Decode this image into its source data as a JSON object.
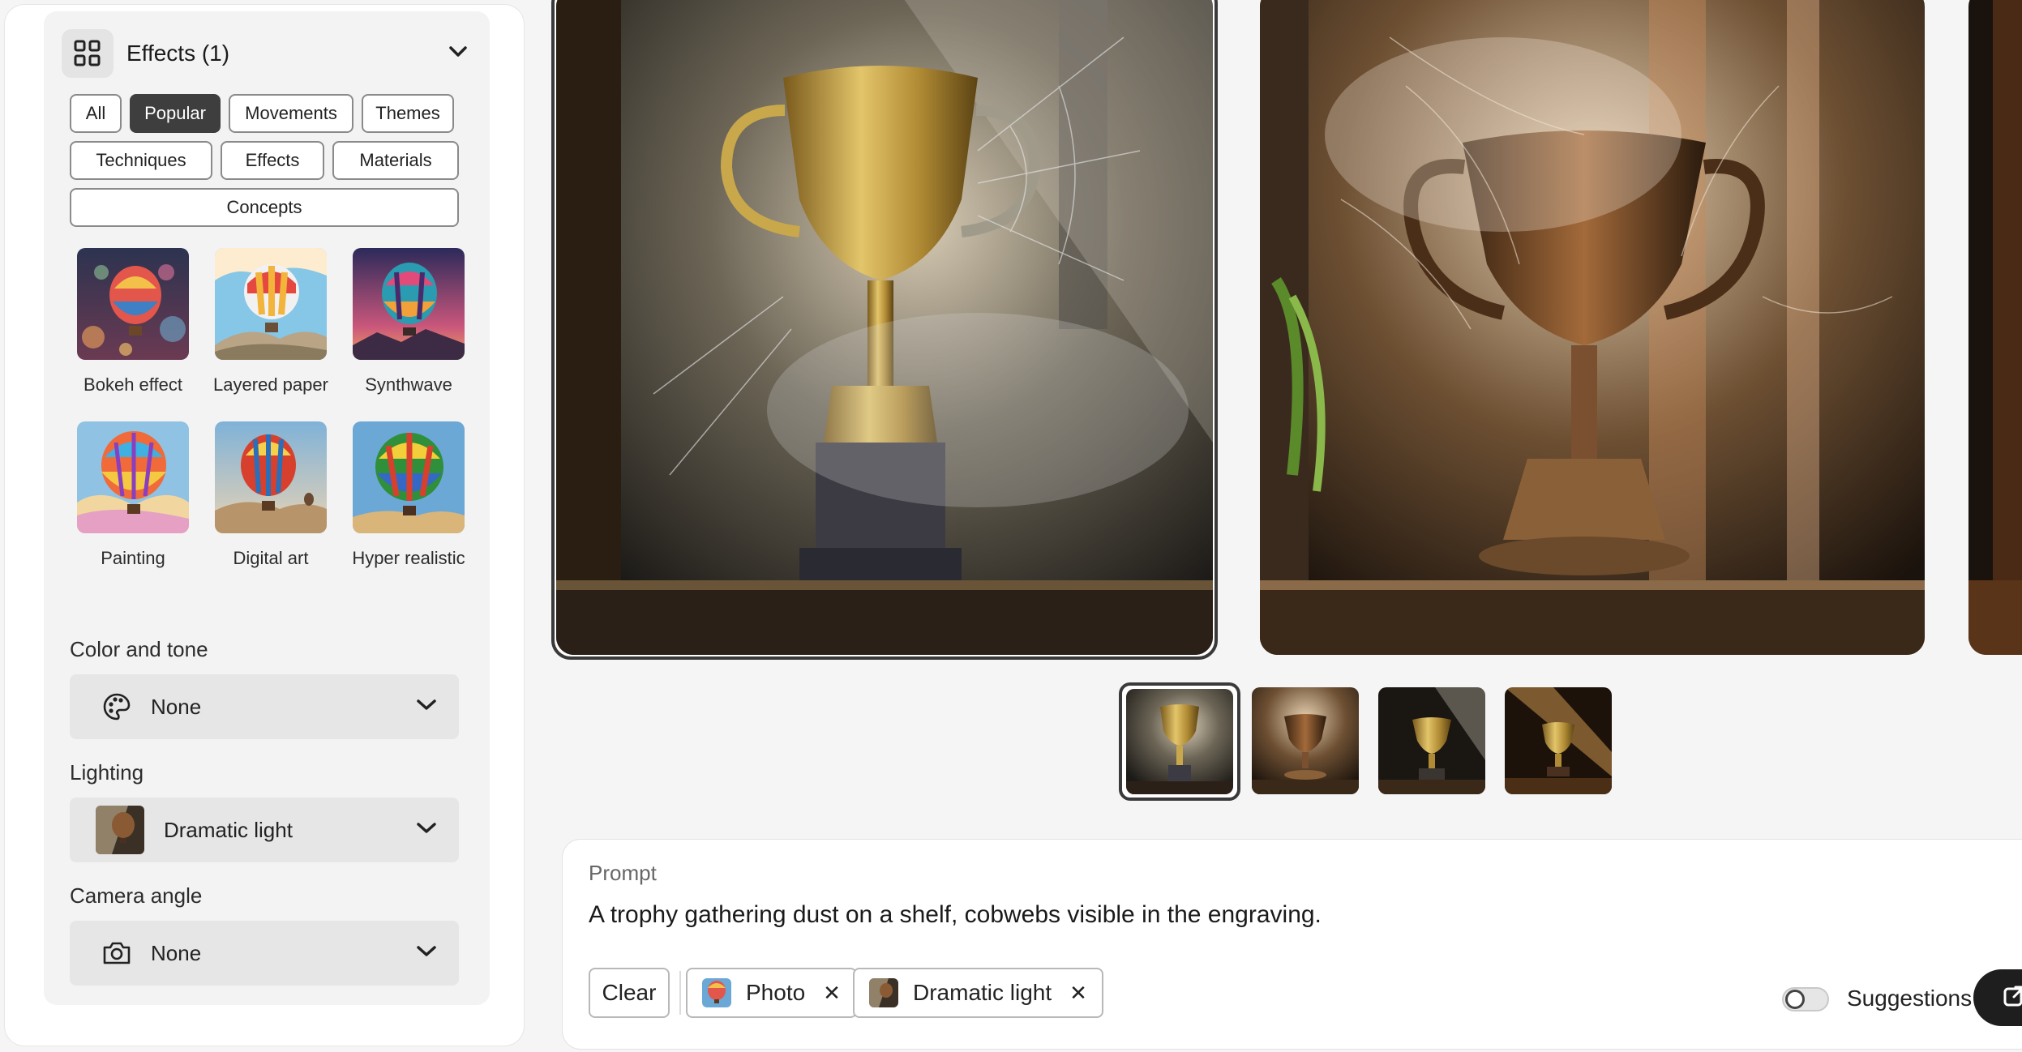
{
  "effects": {
    "title": "Effects (1)",
    "filter_chips": [
      "All",
      "Popular",
      "Movements",
      "Themes",
      "Techniques",
      "Effects",
      "Materials",
      "Concepts"
    ],
    "active_chip": "Popular",
    "styles": [
      {
        "label": "Bokeh effect",
        "icon": "hot-air-balloon-bokeh"
      },
      {
        "label": "Layered paper",
        "icon": "hot-air-balloon-paper"
      },
      {
        "label": "Synthwave",
        "icon": "hot-air-balloon-synthwave"
      },
      {
        "label": "Painting",
        "icon": "hot-air-balloon-painting"
      },
      {
        "label": "Digital art",
        "icon": "hot-air-balloon-digital"
      },
      {
        "label": "Hyper realistic",
        "icon": "hot-air-balloon-realistic"
      }
    ]
  },
  "color_tone": {
    "label": "Color and tone",
    "value": "None",
    "icon": "palette-icon"
  },
  "lighting": {
    "label": "Lighting",
    "value": "Dramatic light",
    "icon": "dramatic-light-thumbnail"
  },
  "camera": {
    "label": "Camera angle",
    "value": "None",
    "icon": "camera-icon"
  },
  "gallery": {
    "selected_index": 0,
    "thumbnail_count": 4
  },
  "prompt": {
    "label": "Prompt",
    "text": "A trophy gathering dust on a shelf, cobwebs visible in the engraving.",
    "clear_label": "Clear",
    "tags": [
      {
        "label": "Photo",
        "icon": "photo-icon"
      },
      {
        "label": "Dramatic light",
        "icon": "dramatic-light-thumbnail"
      }
    ],
    "suggestions_label": "Suggestions",
    "suggestions_on": false
  },
  "colors": {
    "active_chip_bg": "#3e3e3e",
    "panel_bg": "#ffffff",
    "generate_button": "#1e1e1e"
  }
}
